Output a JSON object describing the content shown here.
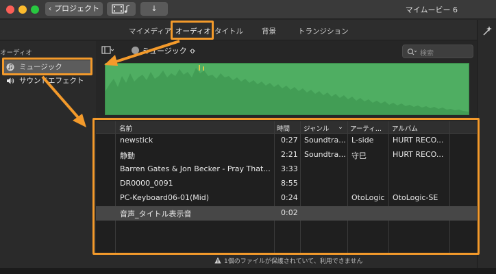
{
  "titlebar": {
    "back_label": "プロジェクト",
    "app_title": "マイムービー 6",
    "colors": {
      "close": "#fc5f57",
      "minimize": "#fdbc2e",
      "zoom": "#28c840"
    }
  },
  "tabs": [
    {
      "label": "マイメディア"
    },
    {
      "label": "オーディオ"
    },
    {
      "label": "タイトル"
    },
    {
      "label": "背景"
    },
    {
      "label": "トランジション"
    }
  ],
  "sidebar": {
    "heading": "オーディオ",
    "items": [
      {
        "label": "ミュージック",
        "icon": "music-note-icon"
      },
      {
        "label": "サウンドエフェクト",
        "icon": "speaker-icon"
      }
    ]
  },
  "toolbar": {
    "source_label": "ミュージック ≎",
    "search_placeholder": "検索"
  },
  "table": {
    "columns": [
      "名前",
      "時間",
      "ジャンル",
      "アーティ...",
      "アルバム"
    ],
    "rows": [
      {
        "name": "newstick",
        "time": "0:27",
        "genre": "Soundtra...",
        "artist": "L-side",
        "album": "HURT RECO..."
      },
      {
        "name": "静動",
        "time": "2:21",
        "genre": "Soundtra...",
        "artist": "守巳",
        "album": "HURT RECO..."
      },
      {
        "name": "Barren Gates & Jon Becker - Pray That...",
        "time": "3:33",
        "genre": "",
        "artist": "",
        "album": ""
      },
      {
        "name": "DR0000_0091",
        "time": "8:55",
        "genre": "",
        "artist": "",
        "album": ""
      },
      {
        "name": "PC-Keyboard06-01(Mid)",
        "time": "0:24",
        "genre": "",
        "artist": "OtoLogic",
        "album": "OtoLogic-SE"
      },
      {
        "name": "音声_タイトル表示音",
        "time": "0:02",
        "genre": "",
        "artist": "",
        "album": ""
      }
    ]
  },
  "footer": {
    "warning": "1個のファイルが保護されていて、利用できません"
  },
  "accent": "#f39a2b"
}
